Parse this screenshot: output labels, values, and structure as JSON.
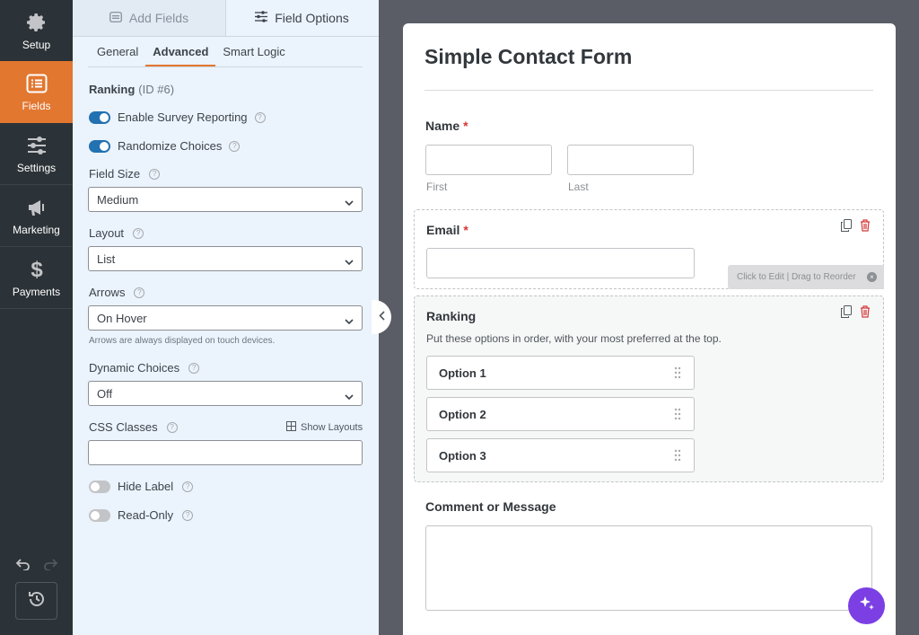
{
  "nav": {
    "items": [
      {
        "label": "Setup",
        "icon": "gear-icon"
      },
      {
        "label": "Fields",
        "icon": "list-icon"
      },
      {
        "label": "Settings",
        "icon": "sliders-icon"
      },
      {
        "label": "Marketing",
        "icon": "megaphone-icon"
      },
      {
        "label": "Payments",
        "icon": "dollar-icon"
      }
    ],
    "active": "Fields"
  },
  "panel": {
    "top_tabs": [
      {
        "label": "Add Fields",
        "icon": "list-icon"
      },
      {
        "label": "Field Options",
        "icon": "sliders-icon"
      }
    ],
    "sub_tabs": [
      "General",
      "Advanced",
      "Smart Logic"
    ],
    "field_name": "Ranking",
    "field_id": "(ID #6)",
    "toggles": {
      "survey": {
        "label": "Enable Survey Reporting",
        "on": true
      },
      "randomize": {
        "label": "Randomize Choices",
        "on": true
      },
      "hide_label": {
        "label": "Hide Label",
        "on": false
      },
      "read_only": {
        "label": "Read-Only",
        "on": false
      }
    },
    "field_size": {
      "label": "Field Size",
      "value": "Medium"
    },
    "layout": {
      "label": "Layout",
      "value": "List"
    },
    "arrows": {
      "label": "Arrows",
      "value": "On Hover",
      "note": "Arrows are always displayed on touch devices."
    },
    "dynamic": {
      "label": "Dynamic Choices",
      "value": "Off"
    },
    "css": {
      "label": "CSS Classes",
      "show_layouts": "Show Layouts"
    }
  },
  "form": {
    "title": "Simple Contact Form",
    "name": {
      "label": "Name",
      "required": "*",
      "first": "First",
      "last": "Last"
    },
    "email": {
      "label": "Email",
      "required": "*"
    },
    "ranking": {
      "label": "Ranking",
      "description": "Put these options in order, with your most preferred at the top.",
      "options": [
        "Option 1",
        "Option 2",
        "Option 3"
      ]
    },
    "comment": {
      "label": "Comment or Message"
    },
    "hint": "Click to Edit | Drag to Reorder"
  },
  "colors": {
    "accent": "#e27730",
    "toggle_on": "#2271b1",
    "fab": "#7b3fe4"
  }
}
